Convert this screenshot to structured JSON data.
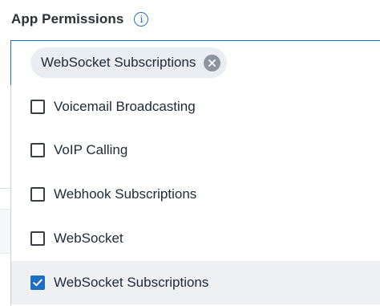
{
  "header": {
    "title": "App Permissions",
    "info_icon": "info-icon",
    "info_symbol": "i"
  },
  "selected_chips": [
    {
      "label": "WebSocket Subscriptions",
      "remove_icon": "close-circle-icon"
    }
  ],
  "options": [
    {
      "label": "Voicemail Broadcasting",
      "checked": false
    },
    {
      "label": "VoIP Calling",
      "checked": false
    },
    {
      "label": "Webhook Subscriptions",
      "checked": false
    },
    {
      "label": "WebSocket",
      "checked": false
    },
    {
      "label": "WebSocket Subscriptions",
      "checked": true
    }
  ],
  "colors": {
    "accent": "#1d6fc2",
    "chip_bg": "#eaedf1",
    "selected_row_bg": "#eef0f3",
    "info_icon": "#2a71b8"
  }
}
